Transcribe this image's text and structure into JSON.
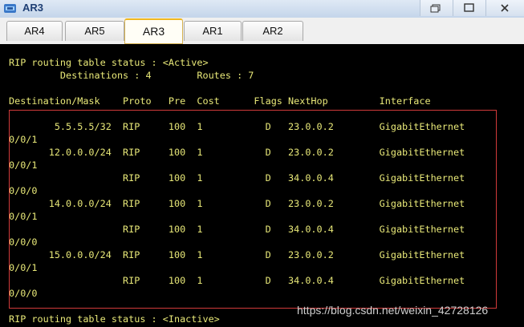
{
  "window": {
    "title": "AR3"
  },
  "tabs": [
    {
      "label": "AR4"
    },
    {
      "label": "AR5"
    },
    {
      "label": "AR3"
    },
    {
      "label": "AR1"
    },
    {
      "label": "AR2"
    }
  ],
  "active_tab": "AR3",
  "terminal": {
    "lines": [
      "RIP routing table status : <Active>",
      "         Destinations : 4        Routes : 7",
      "",
      "Destination/Mask    Proto   Pre  Cost      Flags NextHop         Interface",
      "",
      "        5.5.5.5/32  RIP     100  1           D   23.0.0.2        GigabitEthernet",
      "0/0/1",
      "       12.0.0.0/24  RIP     100  1           D   23.0.0.2        GigabitEthernet",
      "0/0/1",
      "                    RIP     100  1           D   34.0.0.4        GigabitEthernet",
      "0/0/0",
      "       14.0.0.0/24  RIP     100  1           D   23.0.0.2        GigabitEthernet",
      "0/0/1",
      "                    RIP     100  1           D   34.0.0.4        GigabitEthernet",
      "0/0/0",
      "       15.0.0.0/24  RIP     100  1           D   23.0.0.2        GigabitEthernet",
      "0/0/1",
      "                    RIP     100  1           D   34.0.0.4        GigabitEthernet",
      "0/0/0",
      "",
      "RIP routing table status : <Inactive>"
    ]
  },
  "watermark": "https://blog.csdn.net/weixin_42728126",
  "colors": {
    "terminal_bg": "#000000",
    "terminal_text": "#e8e878",
    "highlight_border": "#d13a3a",
    "active_tab_accent": "#f0b820"
  },
  "icons": {
    "app": "router-app-icon",
    "restore": "restore-window-icon",
    "close": "close-icon"
  }
}
